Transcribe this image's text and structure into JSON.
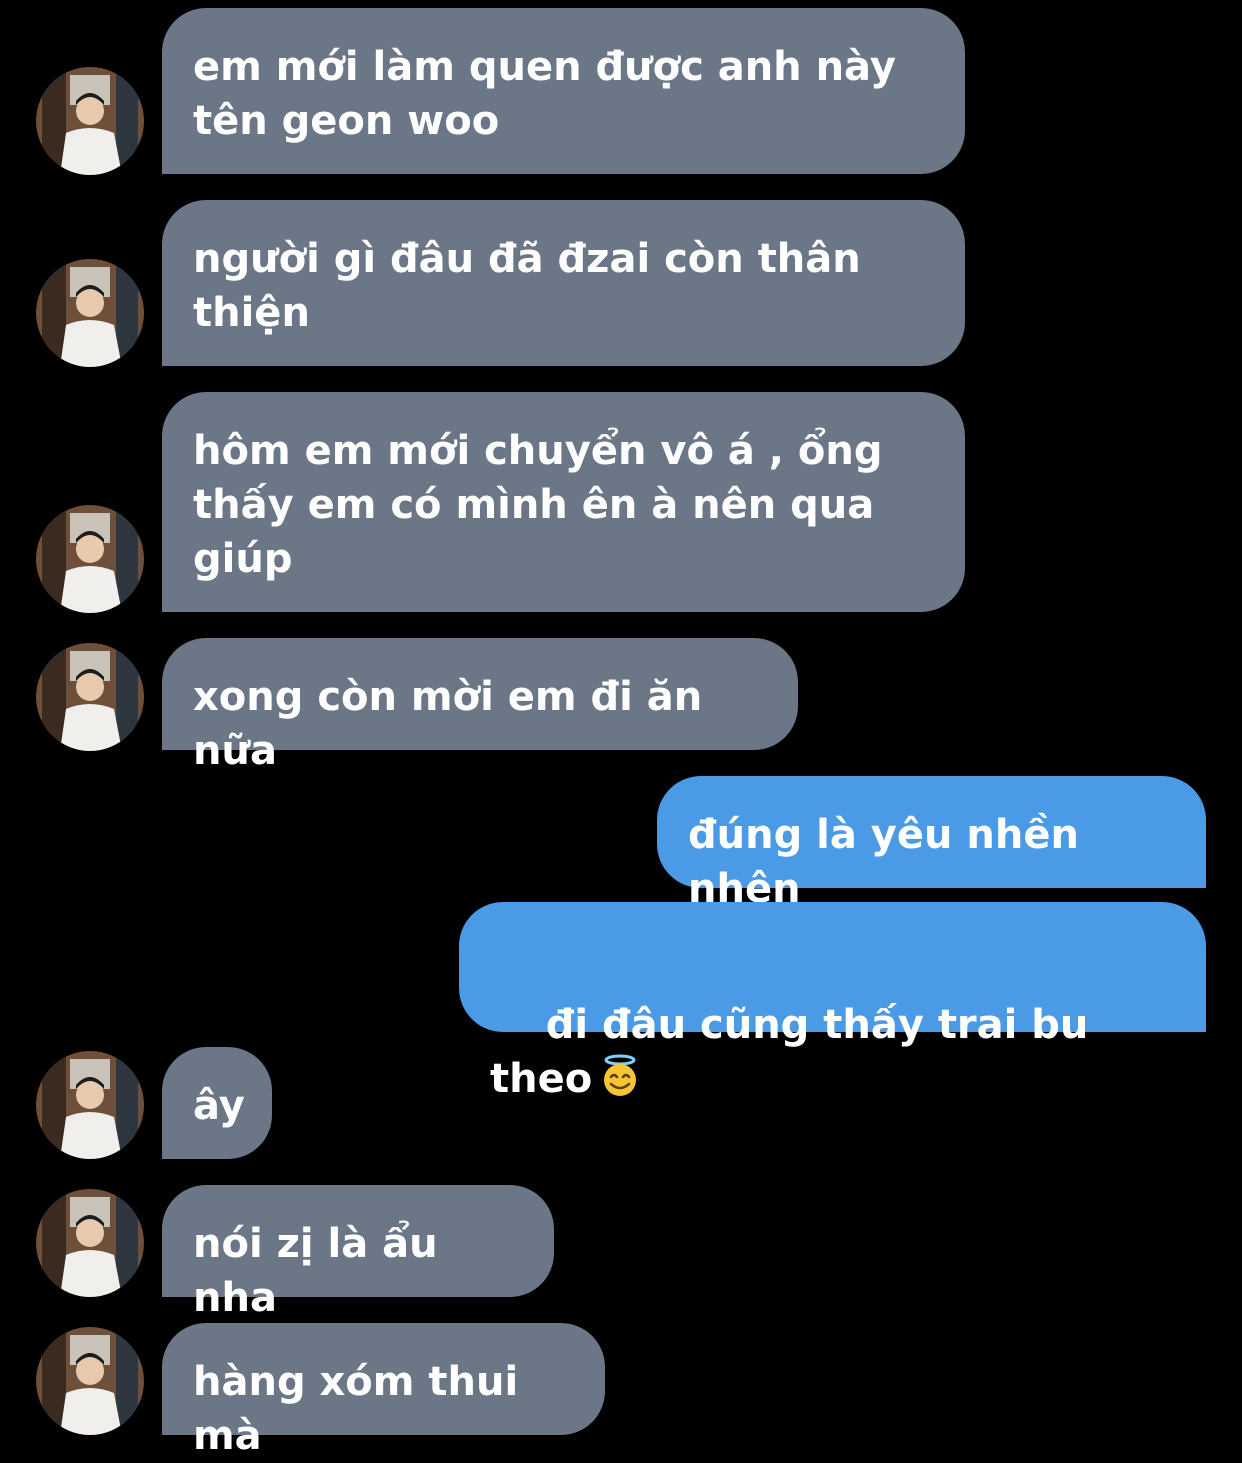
{
  "conversation": {
    "messages": [
      {
        "sender": "contact",
        "text": "em mới làm quen được anh này\ntên geon woo"
      },
      {
        "sender": "contact",
        "text": "người gì đâu đã đzai còn thân\nthiện"
      },
      {
        "sender": "contact",
        "text": "hôm em mới chuyển vô á , ổng\nthấy em có mình ên à nên qua\ngiúp"
      },
      {
        "sender": "contact",
        "text": "xong còn mời em đi ăn nữa"
      },
      {
        "sender": "me",
        "text": "đúng là yêu nhền nhện"
      },
      {
        "sender": "me",
        "text": "đi đâu cũng thấy trai bu theo",
        "emoji": "smiling-face-with-halo-icon"
      },
      {
        "sender": "contact",
        "text": "ây"
      },
      {
        "sender": "contact",
        "text": "nói zị là ẩu nha"
      },
      {
        "sender": "contact",
        "text": "hàng xóm thui mà"
      }
    ]
  },
  "colors": {
    "background": "#000000",
    "incoming_bubble": "#6b7786",
    "outgoing_bubble": "#4a9ae6",
    "text": "#ffffff"
  }
}
